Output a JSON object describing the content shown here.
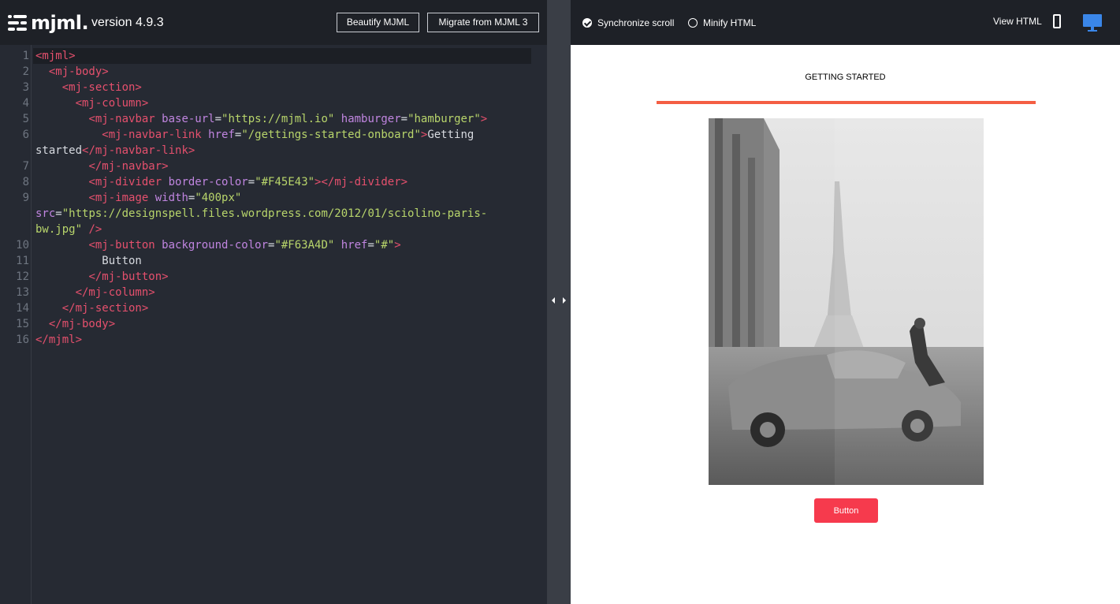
{
  "app": {
    "logo_text": "mjml.",
    "version": "version 4.9.3"
  },
  "toolbar": {
    "beautify_label": "Beautify MJML",
    "migrate_label": "Migrate from MJML 3"
  },
  "editor": {
    "line_numbers": [
      "1",
      "2",
      "3",
      "4",
      "5",
      "6",
      "7",
      "8",
      "9",
      "10",
      "11",
      "12",
      "13",
      "14",
      "15",
      "16"
    ],
    "lines": [
      {
        "n": "1",
        "tokens": [
          {
            "c": "t",
            "v": "<mjml>"
          }
        ]
      },
      {
        "n": "2",
        "tokens": [
          {
            "c": "p",
            "v": "  "
          },
          {
            "c": "t",
            "v": "<mj-body>"
          }
        ]
      },
      {
        "n": "3",
        "tokens": [
          {
            "c": "p",
            "v": "    "
          },
          {
            "c": "t",
            "v": "<mj-section>"
          }
        ]
      },
      {
        "n": "4",
        "tokens": [
          {
            "c": "p",
            "v": "      "
          },
          {
            "c": "t",
            "v": "<mj-column>"
          }
        ]
      },
      {
        "n": "5",
        "tokens": [
          {
            "c": "p",
            "v": "        "
          },
          {
            "c": "t",
            "v": "<mj-navbar "
          },
          {
            "c": "a",
            "v": "base-url"
          },
          {
            "c": "p",
            "v": "="
          },
          {
            "c": "s",
            "v": "\"https://mjml.io\""
          },
          {
            "c": "p",
            "v": " "
          },
          {
            "c": "a",
            "v": "hamburger"
          },
          {
            "c": "p",
            "v": "="
          },
          {
            "c": "s",
            "v": "\"hamburger\""
          },
          {
            "c": "t",
            "v": ">"
          }
        ]
      },
      {
        "n": "6",
        "tokens": [
          {
            "c": "p",
            "v": "          "
          },
          {
            "c": "t",
            "v": "<mj-navbar-link "
          },
          {
            "c": "a",
            "v": "href"
          },
          {
            "c": "p",
            "v": "="
          },
          {
            "c": "s",
            "v": "\"/gettings-started-onboard\""
          },
          {
            "c": "t",
            "v": ">"
          },
          {
            "c": "p",
            "v": "Getting"
          }
        ]
      },
      {
        "n": "",
        "tokens": [
          {
            "c": "p",
            "v": "started"
          },
          {
            "c": "t",
            "v": "</mj-navbar-link>"
          }
        ]
      },
      {
        "n": "7",
        "tokens": [
          {
            "c": "p",
            "v": "        "
          },
          {
            "c": "t",
            "v": "</mj-navbar>"
          }
        ]
      },
      {
        "n": "8",
        "tokens": [
          {
            "c": "p",
            "v": "        "
          },
          {
            "c": "t",
            "v": "<mj-divider "
          },
          {
            "c": "a",
            "v": "border-color"
          },
          {
            "c": "p",
            "v": "="
          },
          {
            "c": "s",
            "v": "\"#F45E43\""
          },
          {
            "c": "t",
            "v": "></mj-divider>"
          }
        ]
      },
      {
        "n": "9",
        "tokens": [
          {
            "c": "p",
            "v": "        "
          },
          {
            "c": "t",
            "v": "<mj-image "
          },
          {
            "c": "a",
            "v": "width"
          },
          {
            "c": "p",
            "v": "="
          },
          {
            "c": "s",
            "v": "\"400px\""
          }
        ]
      },
      {
        "n": "",
        "tokens": [
          {
            "c": "a",
            "v": "src"
          },
          {
            "c": "p",
            "v": "="
          },
          {
            "c": "s",
            "v": "\"https://designspell.files.wordpress.com/2012/01/sciolino-paris-"
          }
        ]
      },
      {
        "n": "",
        "tokens": [
          {
            "c": "s",
            "v": "bw.jpg\""
          },
          {
            "c": "p",
            "v": " "
          },
          {
            "c": "t",
            "v": "/>"
          }
        ]
      },
      {
        "n": "10",
        "tokens": [
          {
            "c": "p",
            "v": "        "
          },
          {
            "c": "t",
            "v": "<mj-button "
          },
          {
            "c": "a",
            "v": "background-color"
          },
          {
            "c": "p",
            "v": "="
          },
          {
            "c": "s",
            "v": "\"#F63A4D\""
          },
          {
            "c": "p",
            "v": " "
          },
          {
            "c": "a",
            "v": "href"
          },
          {
            "c": "p",
            "v": "="
          },
          {
            "c": "s",
            "v": "\"#\""
          },
          {
            "c": "t",
            "v": ">"
          }
        ]
      },
      {
        "n": "11",
        "tokens": [
          {
            "c": "p",
            "v": "          Button"
          }
        ]
      },
      {
        "n": "12",
        "tokens": [
          {
            "c": "p",
            "v": "        "
          },
          {
            "c": "t",
            "v": "</mj-button>"
          }
        ]
      },
      {
        "n": "13",
        "tokens": [
          {
            "c": "p",
            "v": "      "
          },
          {
            "c": "t",
            "v": "</mj-column>"
          }
        ]
      },
      {
        "n": "14",
        "tokens": [
          {
            "c": "p",
            "v": "    "
          },
          {
            "c": "t",
            "v": "</mj-section>"
          }
        ]
      },
      {
        "n": "15",
        "tokens": [
          {
            "c": "p",
            "v": "  "
          },
          {
            "c": "t",
            "v": "</mj-body>"
          }
        ]
      },
      {
        "n": "16",
        "tokens": [
          {
            "c": "t",
            "v": "</mjml>"
          }
        ]
      }
    ]
  },
  "preview_toolbar": {
    "sync_scroll_label": "Synchronize scroll",
    "sync_scroll_checked": true,
    "minify_label": "Minify HTML",
    "minify_checked": false,
    "view_html_label": "View HTML",
    "active_view": "desktop"
  },
  "preview": {
    "nav_link": "GETTING STARTED",
    "divider_color": "#F45E43",
    "button_label": "Button",
    "button_color": "#F63A4D"
  },
  "colors": {
    "editor_bg": "#262a33",
    "topbar_bg": "#1e2127",
    "tag": "#e5506d",
    "attr": "#c085e0",
    "string": "#b8d56b",
    "desktop_icon": "#3a86e8"
  }
}
